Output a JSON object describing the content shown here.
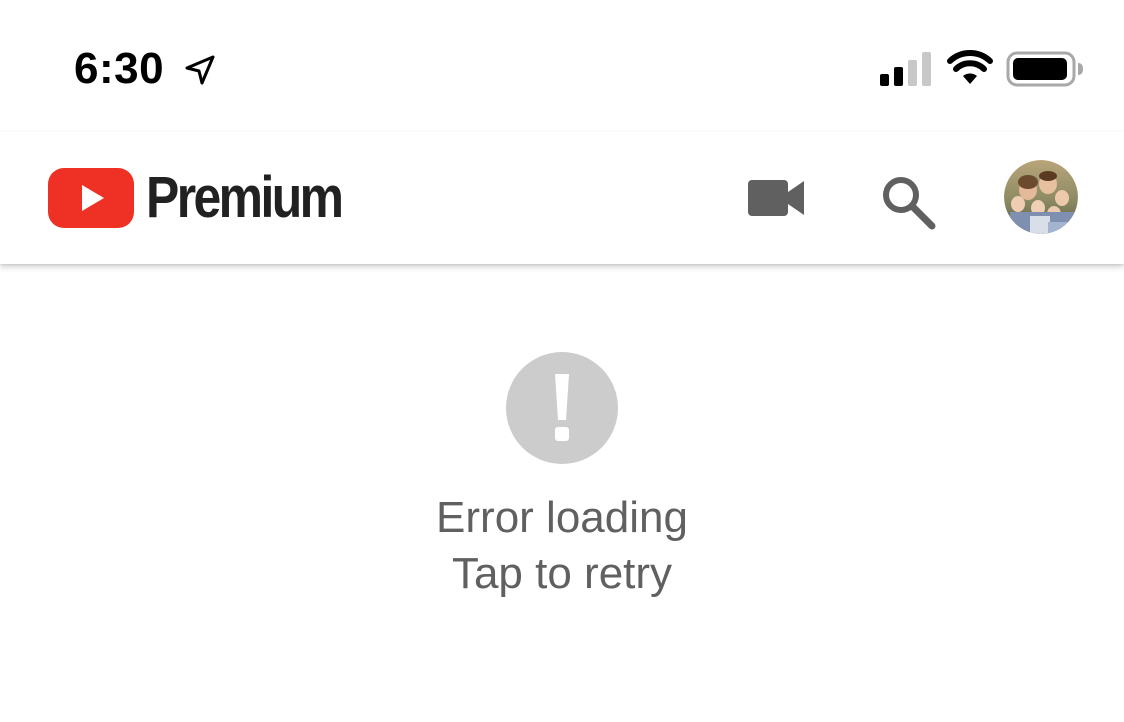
{
  "status_bar": {
    "time": "6:30",
    "icons": [
      "location-arrow-icon",
      "cellular-signal-icon",
      "wifi-icon",
      "battery-icon"
    ]
  },
  "header": {
    "brand_word": "Premium",
    "brand_color": "#ee3124",
    "icons": [
      "youtube-play-icon",
      "video-camera-icon",
      "search-icon",
      "avatar"
    ]
  },
  "error": {
    "title": "Error loading",
    "retry": "Tap to retry",
    "icon": "error-exclamation-icon",
    "icon_color": "#cccccc",
    "text_color": "#606060"
  }
}
